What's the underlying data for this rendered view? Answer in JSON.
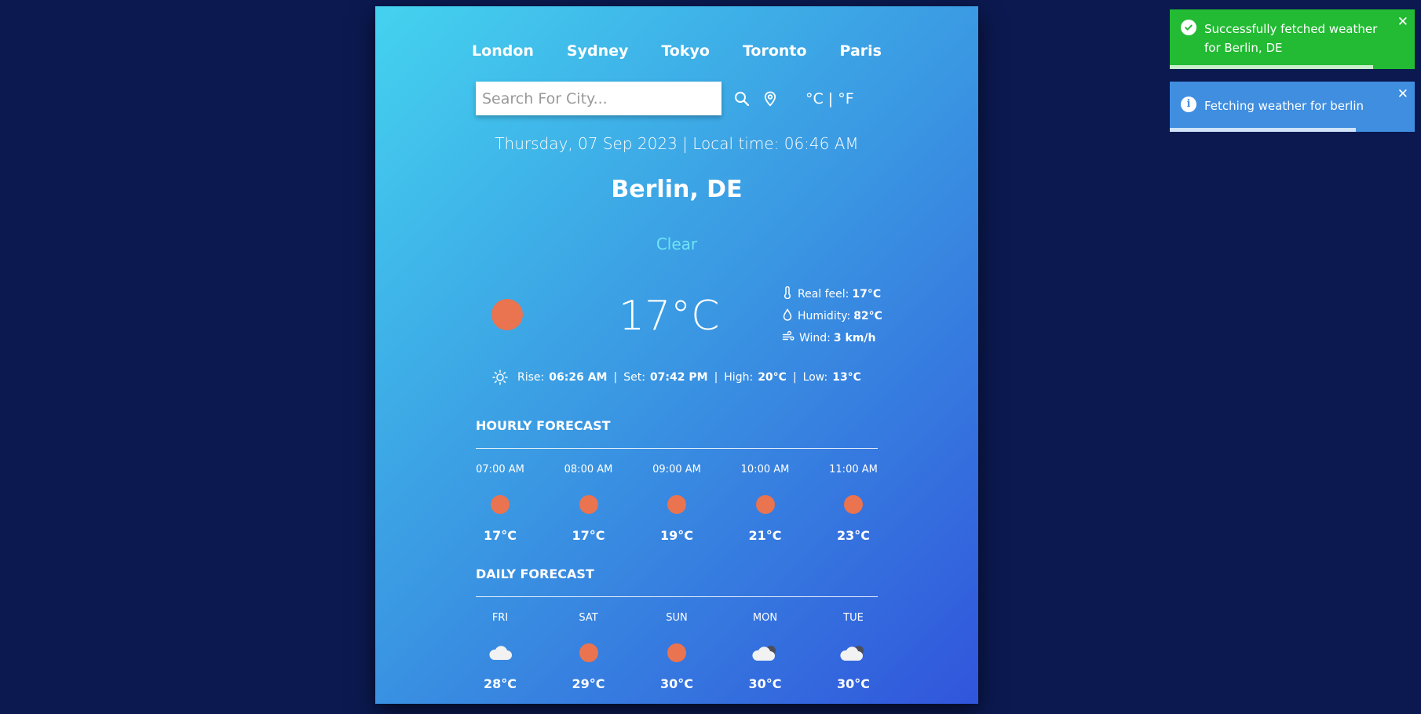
{
  "cities": [
    "London",
    "Sydney",
    "Tokyo",
    "Toronto",
    "Paris"
  ],
  "search": {
    "placeholder": "Search For City..."
  },
  "units_label": "°C | °F",
  "date_line": "Thursday, 07 Sep 2023 | Local time: 06:46 AM",
  "location": "Berlin, DE",
  "condition": "Clear",
  "temperature": "17°C",
  "details": {
    "real_feel_label": "Real feel:",
    "real_feel_value": "17°C",
    "humidity_label": "Humidity:",
    "humidity_value": "82°C",
    "wind_label": "Wind:",
    "wind_value": "3 km/h"
  },
  "sun": {
    "rise_label": "Rise:",
    "rise_value": "06:26 AM",
    "set_label": "Set:",
    "set_value": "07:42 PM",
    "high_label": "High:",
    "high_value": "20°C",
    "low_label": "Low:",
    "low_value": "13°C",
    "separator": "|"
  },
  "hourly": {
    "title": "HOURLY FORECAST",
    "items": [
      {
        "time": "07:00 AM",
        "icon": "sun-icon",
        "temp": "17°C"
      },
      {
        "time": "08:00 AM",
        "icon": "sun-icon",
        "temp": "17°C"
      },
      {
        "time": "09:00 AM",
        "icon": "sun-icon",
        "temp": "19°C"
      },
      {
        "time": "10:00 AM",
        "icon": "sun-icon",
        "temp": "21°C"
      },
      {
        "time": "11:00 AM",
        "icon": "sun-icon",
        "temp": "23°C"
      }
    ]
  },
  "daily": {
    "title": "DAILY FORECAST",
    "items": [
      {
        "day": "FRI",
        "icon": "cloud-icon",
        "temp": "28°C"
      },
      {
        "day": "SAT",
        "icon": "sun-icon",
        "temp": "29°C"
      },
      {
        "day": "SUN",
        "icon": "sun-icon",
        "temp": "30°C"
      },
      {
        "day": "MON",
        "icon": "cloud-night-icon",
        "temp": "30°C"
      },
      {
        "day": "TUE",
        "icon": "cloud-night-icon",
        "temp": "30°C"
      }
    ]
  },
  "toasts": [
    {
      "type": "success",
      "message": "Successfully fetched weather for Berlin, DE",
      "progress": 0.83
    },
    {
      "type": "info",
      "message": "Fetching weather for berlin",
      "progress": 0.76
    }
  ],
  "colors": {
    "page_bg": "#0b1950",
    "card_gradient_start": "#44d2ef",
    "card_gradient_end": "#3155dc",
    "sun": "#ea7350",
    "condition_text": "#6ee5f5",
    "toast_success": "#22bb33",
    "toast_info": "#3f8ee0"
  }
}
